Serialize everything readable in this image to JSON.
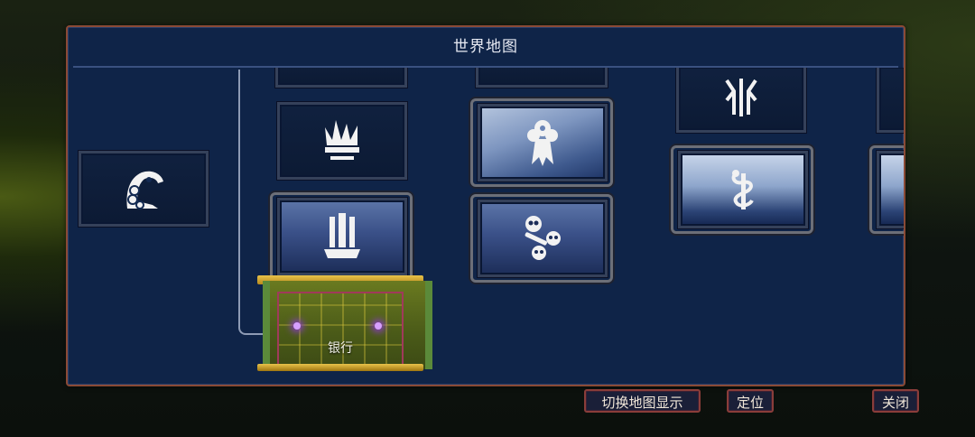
{
  "window": {
    "title": "世界地图"
  },
  "rooms": {
    "bank_label": "银行"
  },
  "buttons": {
    "switch_display": "切换地图显示",
    "locate": "定位",
    "close": "关闭"
  }
}
